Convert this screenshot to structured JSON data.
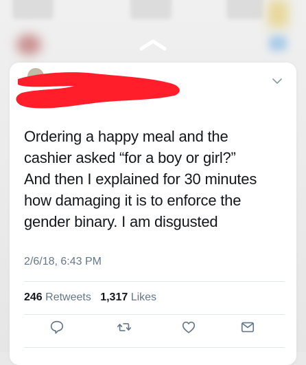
{
  "tweet": {
    "text": "Ordering a happy meal and the\ncashier asked “for a boy or girl?”\nAnd then I explained for 30 minutes\nhow damaging it is to enforce the\ngender binary. I am disgusted",
    "timestamp": "2/6/18, 6:43 PM",
    "retweets_count": "246",
    "retweets_label": "Retweets",
    "likes_count": "1,317",
    "likes_label": "Likes"
  },
  "icons": {
    "handle": "chevron-up-icon",
    "menu": "chevron-down-icon",
    "reply": "reply-icon",
    "retweet": "retweet-icon",
    "like": "heart-icon",
    "share": "mail-icon"
  },
  "colors": {
    "text": "#14171a",
    "secondary": "#657786",
    "redaction": "#ff1e2a",
    "divider": "#e1e8ed"
  }
}
